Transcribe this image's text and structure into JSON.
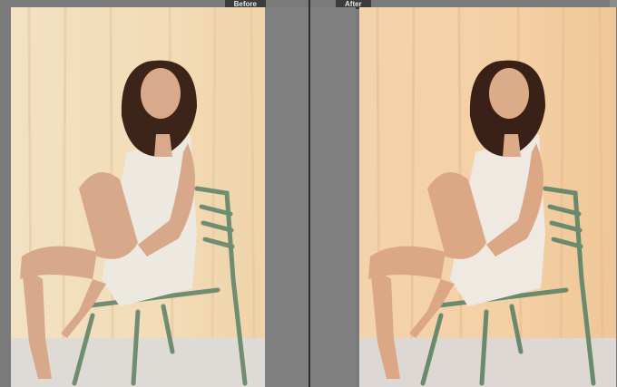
{
  "labels": {
    "before": "Before",
    "after": "After"
  },
  "colors": {
    "before_wall": "#f1dcb8",
    "after_wall": "#f2cfa6",
    "chair": "#6c8b6c",
    "dress": "#ece7df",
    "skin": "#d9ab8c",
    "hair": "#3b2318",
    "floor": "#dcdcdc"
  }
}
